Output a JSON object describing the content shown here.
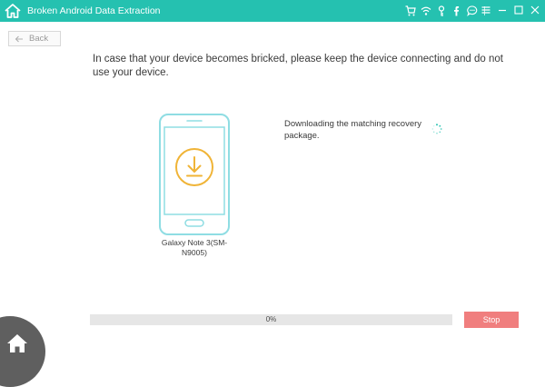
{
  "window": {
    "title": "Broken Android Data Extraction",
    "toolbar_icons": [
      "cart-icon",
      "wifi-icon",
      "key-icon",
      "facebook-icon",
      "chat-icon"
    ],
    "window_controls": [
      "menu-icon",
      "minimize-icon",
      "maximize-icon",
      "close-icon"
    ]
  },
  "nav": {
    "back_label": "Back"
  },
  "main": {
    "notice": "In case that your device becomes bricked, please keep the device connecting and do not use your device.",
    "device_name": "Galaxy Note 3(SM-N9005)",
    "status": "Downloading the matching recovery package."
  },
  "progress": {
    "value": 0,
    "label": "0%"
  },
  "actions": {
    "stop_label": "Stop"
  },
  "colors": {
    "accent": "#25c1b0",
    "stop": "#f07e7e",
    "download": "#f0b437",
    "phone_outline": "#8fdde3"
  }
}
